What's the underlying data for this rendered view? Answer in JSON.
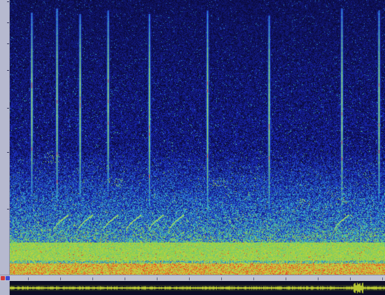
{
  "frequency_axis": {
    "tick_labels": [
      "",
      "",
      "",
      "",
      "",
      "",
      ""
    ]
  },
  "time_ruler": {
    "label": ""
  },
  "waveform_axis": {
    "tick_labels": [
      "",
      "",
      ""
    ]
  },
  "colors": {
    "background": "#0a0a3a",
    "noise_low": "#1c2cc8",
    "noise_mid": "#38b4c8",
    "noise_high": "#8cd24a",
    "hot": "#e83a1e",
    "axis_panel": "#b6b9cf",
    "waveform": "#b8c832"
  },
  "spectrogram": {
    "colormap": [
      "#0a0a3a",
      "#1c2cc8",
      "#38b4c8",
      "#8cd24a",
      "#d8d040",
      "#e83a1e"
    ],
    "call_count": 10,
    "chirp_count": 7
  }
}
